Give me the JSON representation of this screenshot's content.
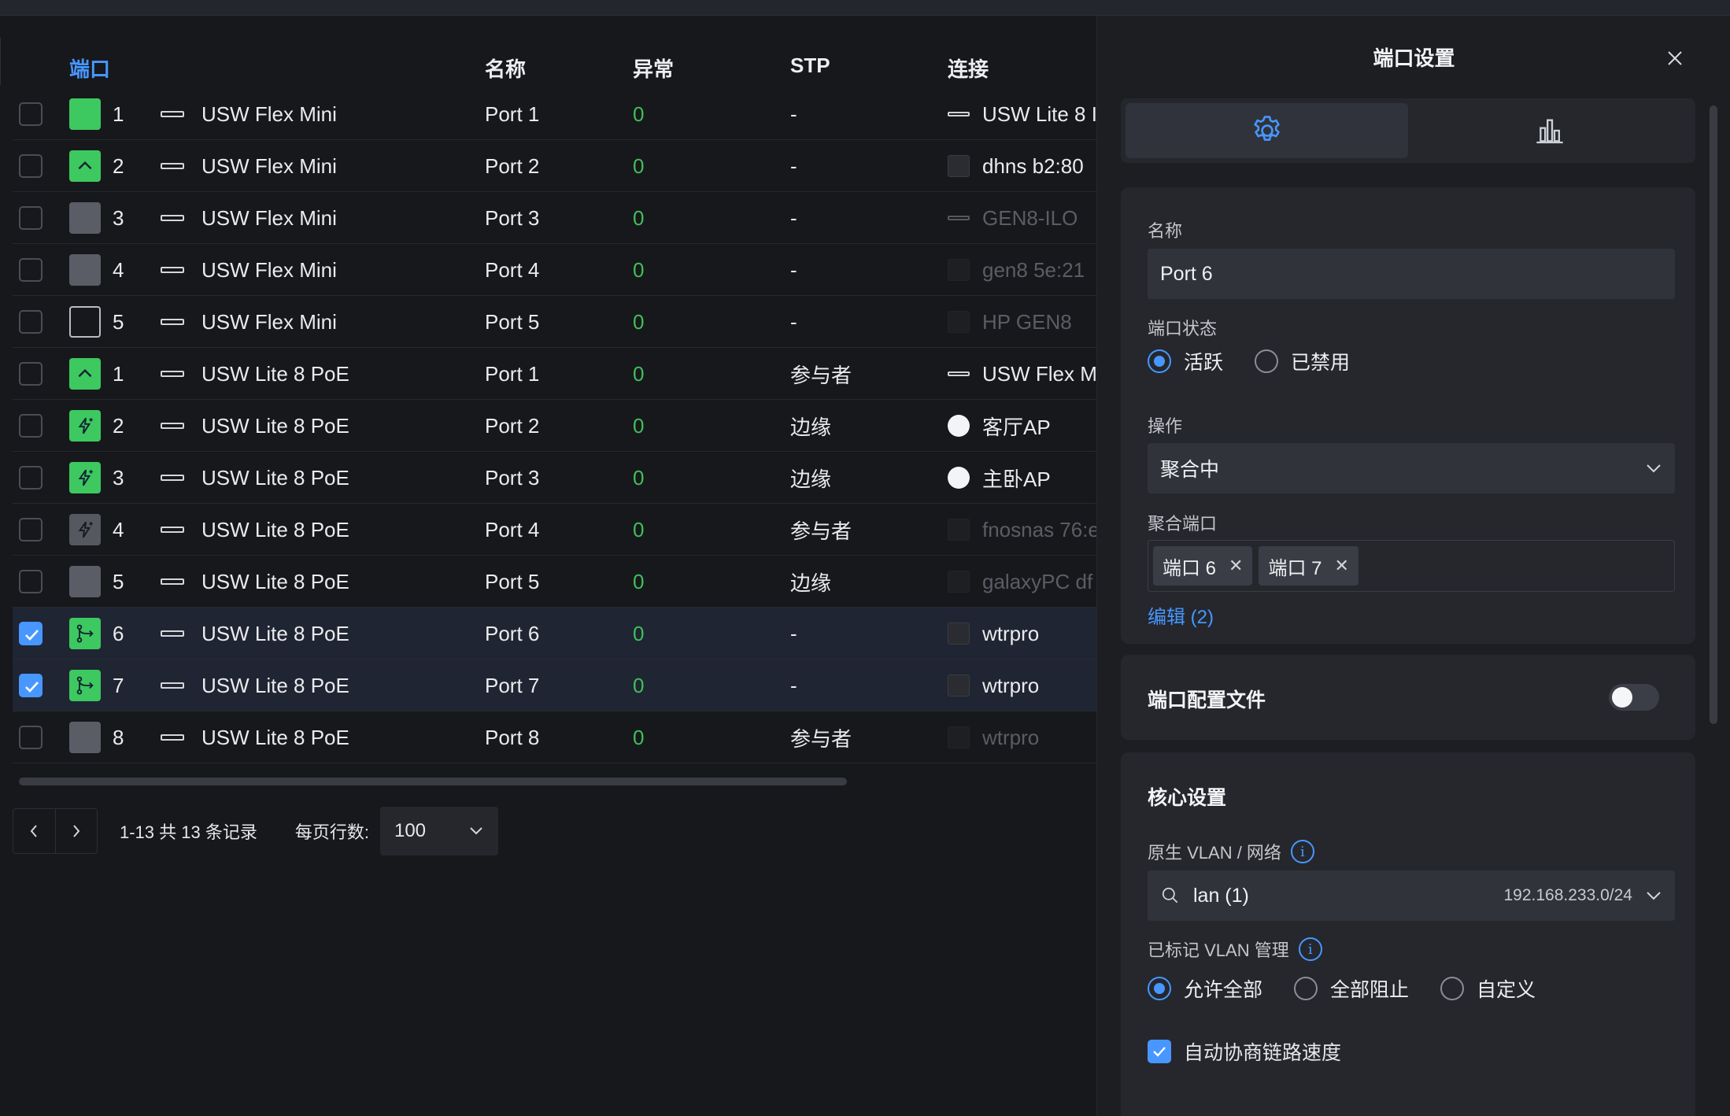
{
  "table": {
    "headers": {
      "port": "端口",
      "name": "名称",
      "errors": "异常",
      "stp": "STP",
      "connection": "连接"
    },
    "rows": [
      {
        "num": "1",
        "device": "USW Flex Mini",
        "name": "Port 1",
        "errors": "0",
        "stp": "-",
        "connection": "USW Lite 8 I",
        "port_icon": "green-solid-port-icon",
        "conn_icon": "switch-icon",
        "selected": false,
        "dim": false
      },
      {
        "num": "2",
        "device": "USW Flex Mini",
        "name": "Port 2",
        "errors": "0",
        "stp": "-",
        "connection": "dhns b2:80",
        "port_icon": "uplink-port-icon",
        "conn_icon": "device-icon",
        "selected": false,
        "dim": false
      },
      {
        "num": "3",
        "device": "USW Flex Mini",
        "name": "Port 3",
        "errors": "0",
        "stp": "-",
        "connection": "GEN8-ILO",
        "port_icon": "gray-port-icon",
        "conn_icon": "switch-icon",
        "selected": false,
        "dim": true
      },
      {
        "num": "4",
        "device": "USW Flex Mini",
        "name": "Port 4",
        "errors": "0",
        "stp": "-",
        "connection": "gen8 5e:21",
        "port_icon": "gray-port-icon",
        "conn_icon": "device-icon",
        "selected": false,
        "dim": true
      },
      {
        "num": "5",
        "device": "USW Flex Mini",
        "name": "Port 5",
        "errors": "0",
        "stp": "-",
        "connection": "HP GEN8",
        "port_icon": "outline-port-icon",
        "conn_icon": "server-icon",
        "selected": false,
        "dim": true
      },
      {
        "num": "1",
        "device": "USW Lite 8 PoE",
        "name": "Port 1",
        "errors": "0",
        "stp": "参与者",
        "connection": "USW Flex M",
        "port_icon": "uplink-port-icon",
        "conn_icon": "switch-icon",
        "selected": false,
        "dim": false
      },
      {
        "num": "2",
        "device": "USW Lite 8 PoE",
        "name": "Port 2",
        "errors": "0",
        "stp": "边缘",
        "connection": "客厅AP",
        "port_icon": "poe-port-icon",
        "conn_icon": "ap-icon",
        "selected": false,
        "dim": false
      },
      {
        "num": "3",
        "device": "USW Lite 8 PoE",
        "name": "Port 3",
        "errors": "0",
        "stp": "边缘",
        "connection": "主卧AP",
        "port_icon": "poe-port-icon",
        "conn_icon": "ap-icon",
        "selected": false,
        "dim": false
      },
      {
        "num": "4",
        "device": "USW Lite 8 PoE",
        "name": "Port 4",
        "errors": "0",
        "stp": "参与者",
        "connection": "fnosnas 76:e",
        "port_icon": "poe-inactive-port-icon",
        "conn_icon": "device-icon",
        "selected": false,
        "dim": true
      },
      {
        "num": "5",
        "device": "USW Lite 8 PoE",
        "name": "Port 5",
        "errors": "0",
        "stp": "边缘",
        "connection": "galaxyPC df",
        "port_icon": "gray-port-icon",
        "conn_icon": "device-icon",
        "selected": false,
        "dim": true
      },
      {
        "num": "6",
        "device": "USW Lite 8 PoE",
        "name": "Port 6",
        "errors": "0",
        "stp": "-",
        "connection": "wtrpro",
        "port_icon": "aggregate-port-icon",
        "conn_icon": "device-icon",
        "selected": true,
        "dim": false
      },
      {
        "num": "7",
        "device": "USW Lite 8 PoE",
        "name": "Port 7",
        "errors": "0",
        "stp": "-",
        "connection": "wtrpro",
        "port_icon": "aggregate-port-icon",
        "conn_icon": "device-icon",
        "selected": true,
        "dim": false
      },
      {
        "num": "8",
        "device": "USW Lite 8 PoE",
        "name": "Port 8",
        "errors": "0",
        "stp": "参与者",
        "connection": "wtrpro",
        "port_icon": "gray-port-icon",
        "conn_icon": "device-icon",
        "selected": false,
        "dim": true
      }
    ]
  },
  "pager": {
    "range": "1-13 共 13 条记录",
    "rows_label": "每页行数:",
    "rows_value": "100"
  },
  "panel": {
    "title": "端口设置",
    "tabs": [
      "settings-gear-icon",
      "stats-bar-chart-icon"
    ],
    "name_label": "名称",
    "name_value": "Port 6",
    "status_label": "端口状态",
    "status_options": [
      "活跃",
      "已禁用"
    ],
    "status_selected": "活跃",
    "operation_label": "操作",
    "operation_value": "聚合中",
    "agg_label": "聚合端口",
    "agg_tags": [
      "端口 6",
      "端口 7"
    ],
    "edit_link": "编辑 (2)",
    "profile_label": "端口配置文件",
    "profile_enabled": false,
    "core_title": "核心设置",
    "native_vlan_label": "原生 VLAN / 网络",
    "native_vlan_value": "lan (1)",
    "native_vlan_subnet": "192.168.233.0/24",
    "tagged_vlan_label": "已标记 VLAN 管理",
    "tagged_options": [
      "允许全部",
      "全部阻止",
      "自定义"
    ],
    "tagged_selected": "允许全部",
    "autoneg_label": "自动协商链路速度",
    "autoneg_checked": true
  },
  "colors": {
    "accent": "#4797ff",
    "ok_green": "#3fbf5a",
    "port_green": "#3dc860"
  }
}
